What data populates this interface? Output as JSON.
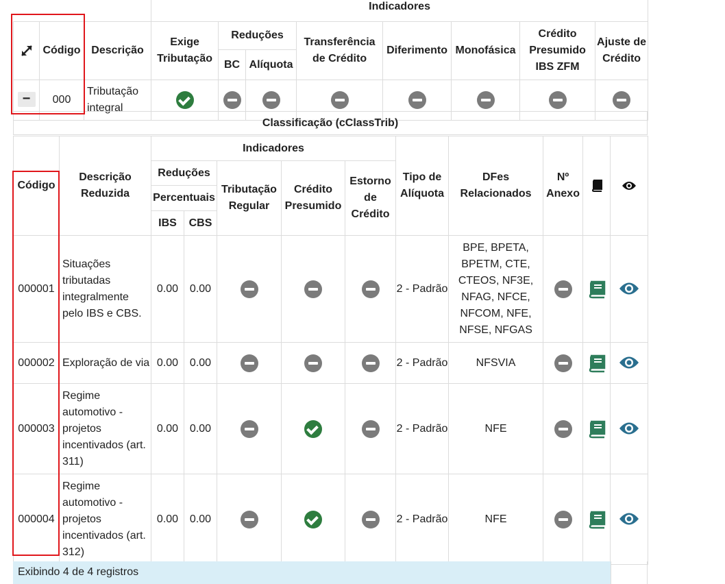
{
  "top": {
    "header": {
      "indicadores": "Indicadores",
      "codigo": "Código",
      "descricao": "Descrição",
      "exige_tributacao": "Exige Tributação",
      "reducoes": "Reduções",
      "bc": "BC",
      "aliquota": "Alíquota",
      "transferencia": "Transferência de Crédito",
      "diferimento": "Diferimento",
      "monofasica": "Monofásica",
      "credito_presumido_zfm": "Crédito Presumido IBS ZFM",
      "ajuste_credito": "Ajuste de Crédito"
    },
    "row": {
      "collapse": "−",
      "codigo": "000",
      "descricao": "Tributação integral"
    }
  },
  "classificacao_title": "Classificação (cClassTrib)",
  "sub": {
    "header": {
      "codigo": "Código",
      "descricao_reduzida": "Descrição Reduzida",
      "indicadores": "Indicadores",
      "reducoes": "Reduções",
      "percentuais": "Percentuais",
      "ibs": "IBS",
      "cbs": "CBS",
      "tributacao_regular": "Tributação Regular",
      "credito_presumido": "Crédito Presumido",
      "estorno_credito": "Estorno de Crédito",
      "tipo_aliquota": "Tipo de Alíquota",
      "dfes": "DFes Relacionados",
      "n_anexo": "Nº Anexo"
    },
    "rows": [
      {
        "codigo": "000001",
        "descricao": "Situações tributadas integralmente pelo IBS e CBS.",
        "ibs": "0.00",
        "cbs": "0.00",
        "credito_presumido": false,
        "tipo": "2 - Padrão",
        "dfes": "BPE, BPETA, BPETM, CTE, CTEOS, NF3E, NFAG, NFCE, NFCOM, NFE, NFSE, NFGAS"
      },
      {
        "codigo": "000002",
        "descricao": "Exploração de via",
        "ibs": "0.00",
        "cbs": "0.00",
        "credito_presumido": false,
        "tipo": "2 - Padrão",
        "dfes": "NFSVIA"
      },
      {
        "codigo": "000003",
        "descricao": "Regime automotivo - projetos incentivados (art. 311)",
        "ibs": "0.00",
        "cbs": "0.00",
        "credito_presumido": true,
        "tipo": "2 - Padrão",
        "dfes": "NFE"
      },
      {
        "codigo": "000004",
        "descricao": "Regime automotivo - projetos incentivados (art. 312)",
        "ibs": "0.00",
        "cbs": "0.00",
        "credito_presumido": true,
        "tipo": "2 - Padrão",
        "dfes": "NFE"
      }
    ]
  },
  "footer": "Exibindo 4 de 4 registros",
  "colors": {
    "green": "#2e7d3f",
    "gray": "#7b7b7b",
    "teal": "#2b8a7a",
    "blue": "#2a6f8f",
    "highlight": "#e0161b"
  }
}
